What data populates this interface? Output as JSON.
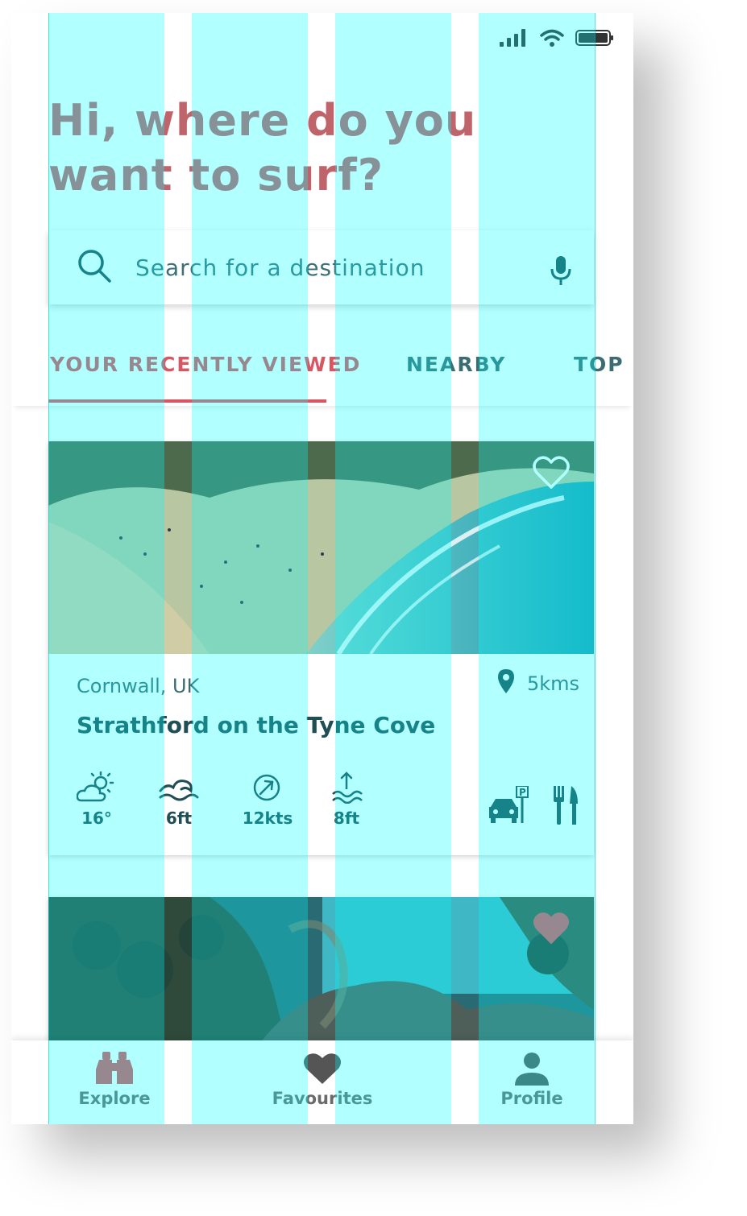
{
  "colors": {
    "accent": "#d85561",
    "greeting": "#c0646b",
    "teal_text": "#3a6c72",
    "dark_teal": "#1f4e54",
    "grid_overlay": "#00ffff"
  },
  "status_bar": {
    "icons": [
      "signal-icon",
      "wifi-icon",
      "battery-icon"
    ]
  },
  "greeting": {
    "line1": "Hi, where do you",
    "line2": "want to surf?"
  },
  "search": {
    "placeholder": "Search for a destination",
    "icons": [
      "search-icon",
      "microphone-icon"
    ]
  },
  "tabs": [
    {
      "label": "YOUR RECENTLY VIEWED",
      "active": true
    },
    {
      "label": "NEARBY",
      "active": false
    },
    {
      "label": "TOP P",
      "active": false
    }
  ],
  "cards": [
    {
      "location": "Cornwall, UK",
      "distance": "5kms",
      "name": "Strathford on the Tyne Cove",
      "favourited": false,
      "metrics": [
        {
          "icon": "weather-icon",
          "value": "16°"
        },
        {
          "icon": "wave-icon",
          "value": "6ft"
        },
        {
          "icon": "wind-icon",
          "value": "12kts"
        },
        {
          "icon": "tide-icon",
          "value": "8ft"
        }
      ],
      "amenities": [
        "parking-icon",
        "restaurant-icon"
      ]
    },
    {
      "favourited": true
    }
  ],
  "bottom_nav": [
    {
      "label": "Explore",
      "icon": "binoculars-icon",
      "active": true
    },
    {
      "label": "Favourites",
      "icon": "heart-icon",
      "active": false
    },
    {
      "label": "Profile",
      "icon": "user-icon",
      "active": false
    }
  ]
}
